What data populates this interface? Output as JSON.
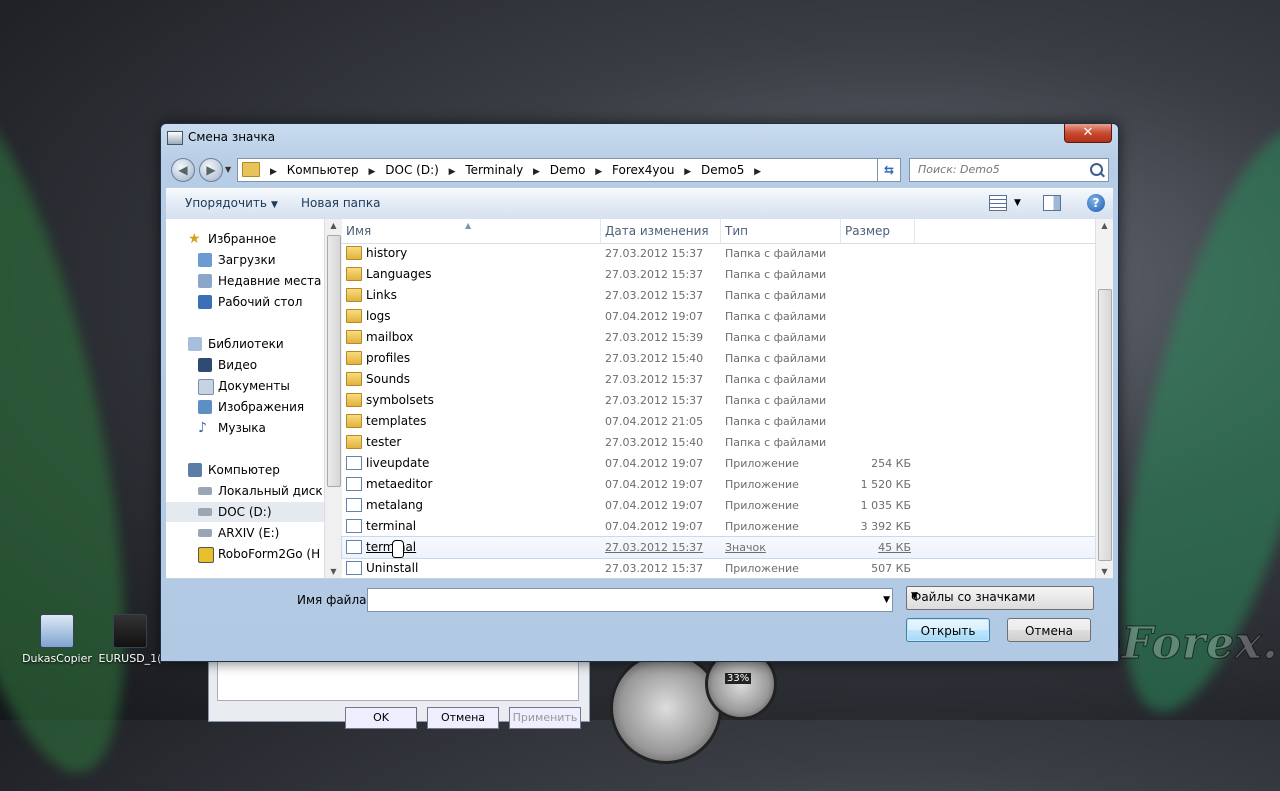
{
  "dialog": {
    "title": "Смена значка",
    "close_label": "✕"
  },
  "address": {
    "crumbs": [
      "Компьютер",
      "DOC (D:)",
      "Terminaly",
      "Demo",
      "Forex4you",
      "Demo5"
    ],
    "search_placeholder": "Поиск: Demo5"
  },
  "toolbar": {
    "organize_label": "Упорядочить",
    "new_folder_label": "Новая папка",
    "help_label": "?"
  },
  "nav": {
    "favorites": {
      "label": "Избранное",
      "items": [
        "Загрузки",
        "Недавние места",
        "Рабочий стол"
      ]
    },
    "libraries": {
      "label": "Библиотеки",
      "items": [
        "Видео",
        "Документы",
        "Изображения",
        "Музыка"
      ]
    },
    "computer": {
      "label": "Компьютер",
      "items": [
        "Локальный диск",
        "DOC (D:)",
        "ARXIV (E:)",
        "RoboForm2Go (H"
      ]
    }
  },
  "columns": {
    "name": "Имя",
    "date": "Дата изменения",
    "type": "Тип",
    "size": "Размер"
  },
  "files": [
    {
      "name": "history",
      "date": "27.03.2012 15:37",
      "type": "Папка с файлами",
      "size": "",
      "kind": "folder"
    },
    {
      "name": "Languages",
      "date": "27.03.2012 15:37",
      "type": "Папка с файлами",
      "size": "",
      "kind": "folder"
    },
    {
      "name": "Links",
      "date": "27.03.2012 15:37",
      "type": "Папка с файлами",
      "size": "",
      "kind": "folder"
    },
    {
      "name": "logs",
      "date": "07.04.2012 19:07",
      "type": "Папка с файлами",
      "size": "",
      "kind": "folder"
    },
    {
      "name": "mailbox",
      "date": "27.03.2012 15:39",
      "type": "Папка с файлами",
      "size": "",
      "kind": "folder"
    },
    {
      "name": "profiles",
      "date": "27.03.2012 15:40",
      "type": "Папка с файлами",
      "size": "",
      "kind": "folder"
    },
    {
      "name": "Sounds",
      "date": "27.03.2012 15:37",
      "type": "Папка с файлами",
      "size": "",
      "kind": "folder"
    },
    {
      "name": "symbolsets",
      "date": "27.03.2012 15:37",
      "type": "Папка с файлами",
      "size": "",
      "kind": "folder"
    },
    {
      "name": "templates",
      "date": "07.04.2012 21:05",
      "type": "Папка с файлами",
      "size": "",
      "kind": "folder"
    },
    {
      "name": "tester",
      "date": "27.03.2012 15:40",
      "type": "Папка с файлами",
      "size": "",
      "kind": "folder"
    },
    {
      "name": "liveupdate",
      "date": "07.04.2012 19:07",
      "type": "Приложение",
      "size": "254 КБ",
      "kind": "app"
    },
    {
      "name": "metaeditor",
      "date": "07.04.2012 19:07",
      "type": "Приложение",
      "size": "1 520 КБ",
      "kind": "app"
    },
    {
      "name": "metalang",
      "date": "07.04.2012 19:07",
      "type": "Приложение",
      "size": "1 035 КБ",
      "kind": "app"
    },
    {
      "name": "terminal",
      "date": "07.04.2012 19:07",
      "type": "Приложение",
      "size": "3 392 КБ",
      "kind": "app"
    },
    {
      "name": "terminal",
      "date": "27.03.2012 15:37",
      "type": "Значок",
      "size": "45 КБ",
      "kind": "icon"
    },
    {
      "name": "Uninstall",
      "date": "27.03.2012 15:37",
      "type": "Приложение",
      "size": "507 КБ",
      "kind": "app"
    }
  ],
  "bottom": {
    "filename_label": "Имя файла:",
    "filename_value": "",
    "filter_value": "Файлы со значками",
    "open_label": "Открыть",
    "cancel_label": "Отмена"
  },
  "desktop": {
    "icons": [
      "DukasCopier",
      "EURUSD_1("
    ],
    "watermark": "AutoForex.ru",
    "gauge_value": "33%",
    "bg_ok": "OK",
    "bg_cancel": "Отмена",
    "bg_apply": "Применить"
  }
}
